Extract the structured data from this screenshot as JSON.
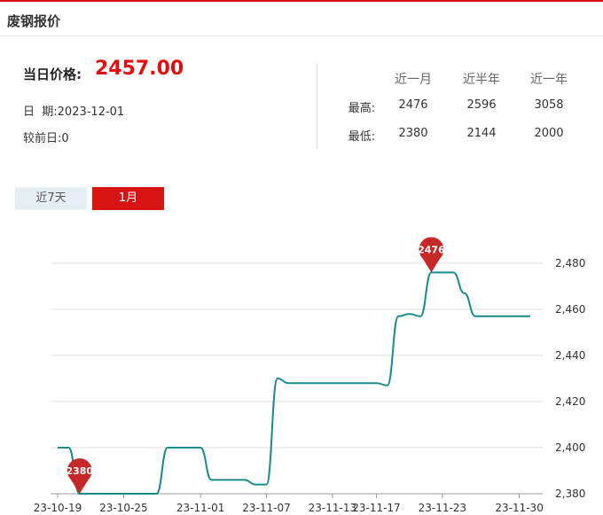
{
  "header": {
    "title": "废钢报价"
  },
  "summary": {
    "price_label": "当日价格:",
    "price_value": "2457.00",
    "date_label": "日  期:",
    "date_value": "2023-12-01",
    "change_label": "较前日:",
    "change_value": "0"
  },
  "stats": {
    "columns": [
      "近一月",
      "近半年",
      "近一年"
    ],
    "rows": [
      {
        "label": "最高:",
        "values": [
          "2476",
          "2596",
          "3058"
        ]
      },
      {
        "label": "最低:",
        "values": [
          "2380",
          "2144",
          "2000"
        ]
      }
    ]
  },
  "tabs": [
    {
      "label": "近7天",
      "active": false
    },
    {
      "label": "1月",
      "active": true
    }
  ],
  "colors": {
    "accent": "#d71414",
    "line": "#1a8a8a",
    "pin": "#c62828"
  },
  "chart_data": {
    "type": "line",
    "x_ticks": [
      "23-10-19",
      "23-10-25",
      "23-11-01",
      "23-11-07",
      "23-11-13",
      "23-11-17",
      "23-11-23",
      "23-11-30"
    ],
    "y_ticks": [
      "2,380",
      "2,400",
      "2,420",
      "2,440",
      "2,460",
      "2,480"
    ],
    "ylim": [
      2380,
      2480
    ],
    "grid": true,
    "series": [
      {
        "x": [
          "23-10-19",
          "23-10-20",
          "23-10-21",
          "23-10-22",
          "23-10-23",
          "23-10-24",
          "23-10-25",
          "23-10-26",
          "23-10-27",
          "23-10-28",
          "23-10-29",
          "23-10-30",
          "23-10-31",
          "23-11-01",
          "23-11-02",
          "23-11-03",
          "23-11-04",
          "23-11-05",
          "23-11-06",
          "23-11-07",
          "23-11-08",
          "23-11-09",
          "23-11-10",
          "23-11-11",
          "23-11-12",
          "23-11-13",
          "23-11-14",
          "23-11-15",
          "23-11-16",
          "23-11-17",
          "23-11-18",
          "23-11-19",
          "23-11-20",
          "23-11-21",
          "23-11-22",
          "23-11-23",
          "23-11-24",
          "23-11-25",
          "23-11-26",
          "23-11-27",
          "23-11-28",
          "23-11-29",
          "23-11-30",
          "23-12-01"
        ],
        "values": [
          2400,
          2400,
          2380,
          2380,
          2380,
          2380,
          2380,
          2380,
          2380,
          2380,
          2400,
          2400,
          2400,
          2400,
          2386,
          2386,
          2386,
          2386,
          2384,
          2384,
          2430,
          2428,
          2428,
          2428,
          2428,
          2428,
          2428,
          2428,
          2428,
          2428,
          2427,
          2457,
          2458,
          2457,
          2476,
          2476,
          2476,
          2467,
          2457,
          2457,
          2457,
          2457,
          2457,
          2457
        ]
      }
    ],
    "markers": [
      {
        "label": "2476",
        "x": "23-11-22",
        "value": 2476
      },
      {
        "label": "2380",
        "x": "23-10-21",
        "value": 2380
      }
    ]
  }
}
